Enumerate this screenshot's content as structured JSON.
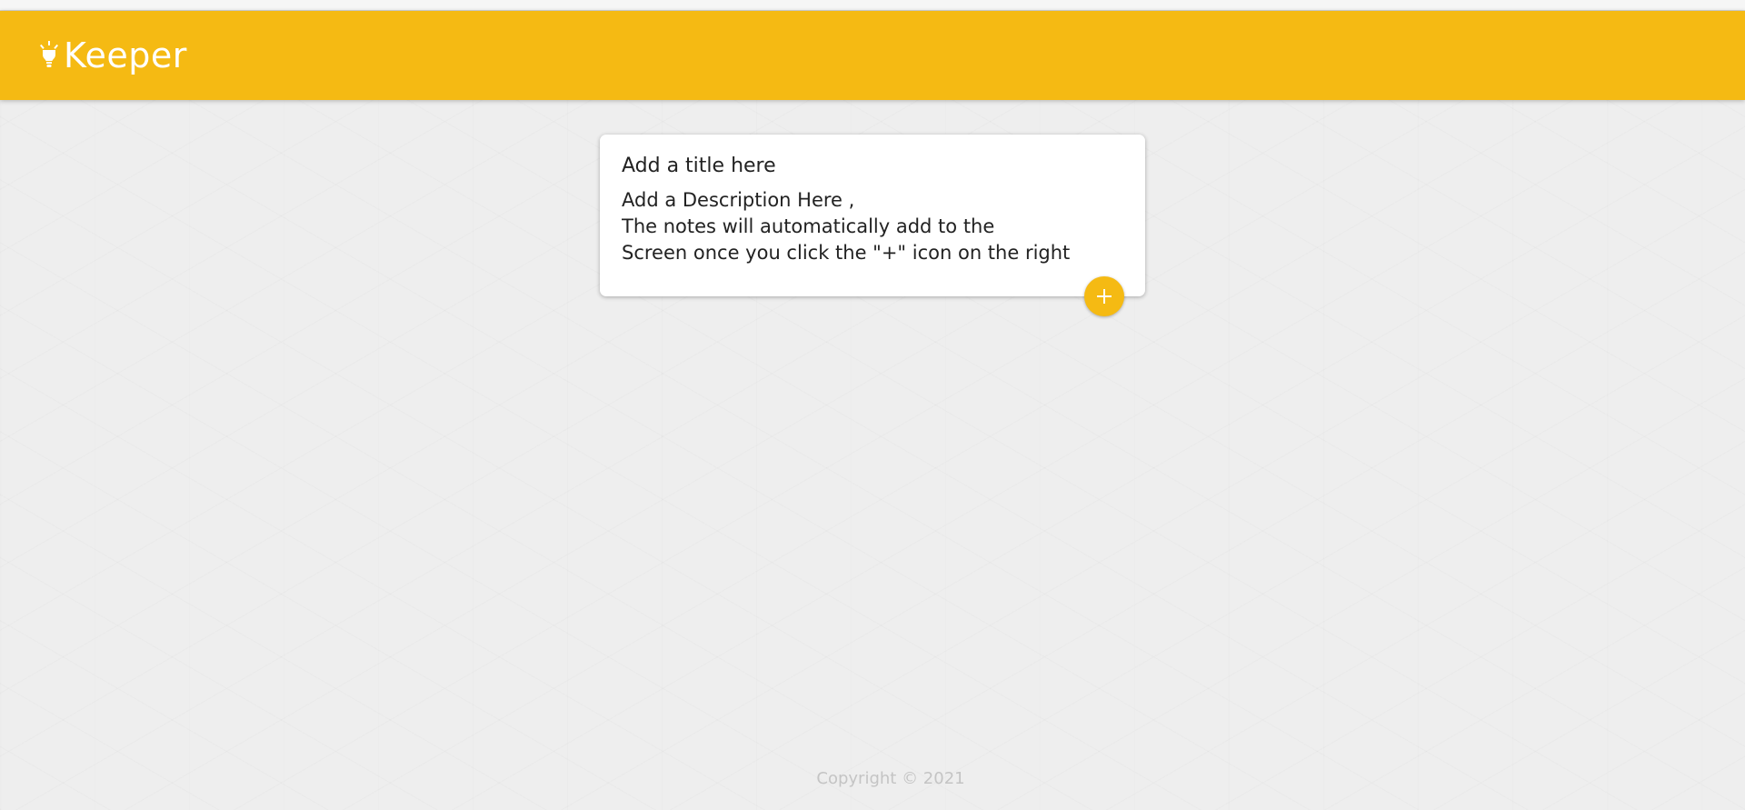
{
  "header": {
    "brand_icon": "lightbulb-icon",
    "title": "Keeper",
    "bg_color": "#f5ba13"
  },
  "create_note": {
    "title_value": "Add a title here",
    "content_value": "Add a Description Here ,\nThe notes will automatically add to the\nScreen once you click the \"+\" icon on the right",
    "add_button_icon": "plus-icon"
  },
  "footer": {
    "text": "Copyright © 2021"
  }
}
